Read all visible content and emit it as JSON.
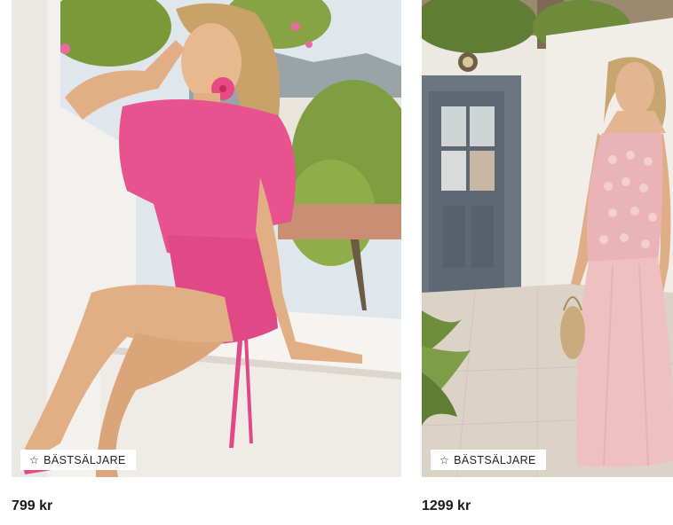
{
  "products": [
    {
      "badge": "BÄSTSÄLJARE",
      "badge_icon": "star-outline-icon",
      "price": "799 kr",
      "dress_color": "#e8528f"
    },
    {
      "badge": "BÄSTSÄLJARE",
      "badge_icon": "star-outline-icon",
      "price": "1299 kr",
      "dress_color": "#eab4b6"
    }
  ]
}
